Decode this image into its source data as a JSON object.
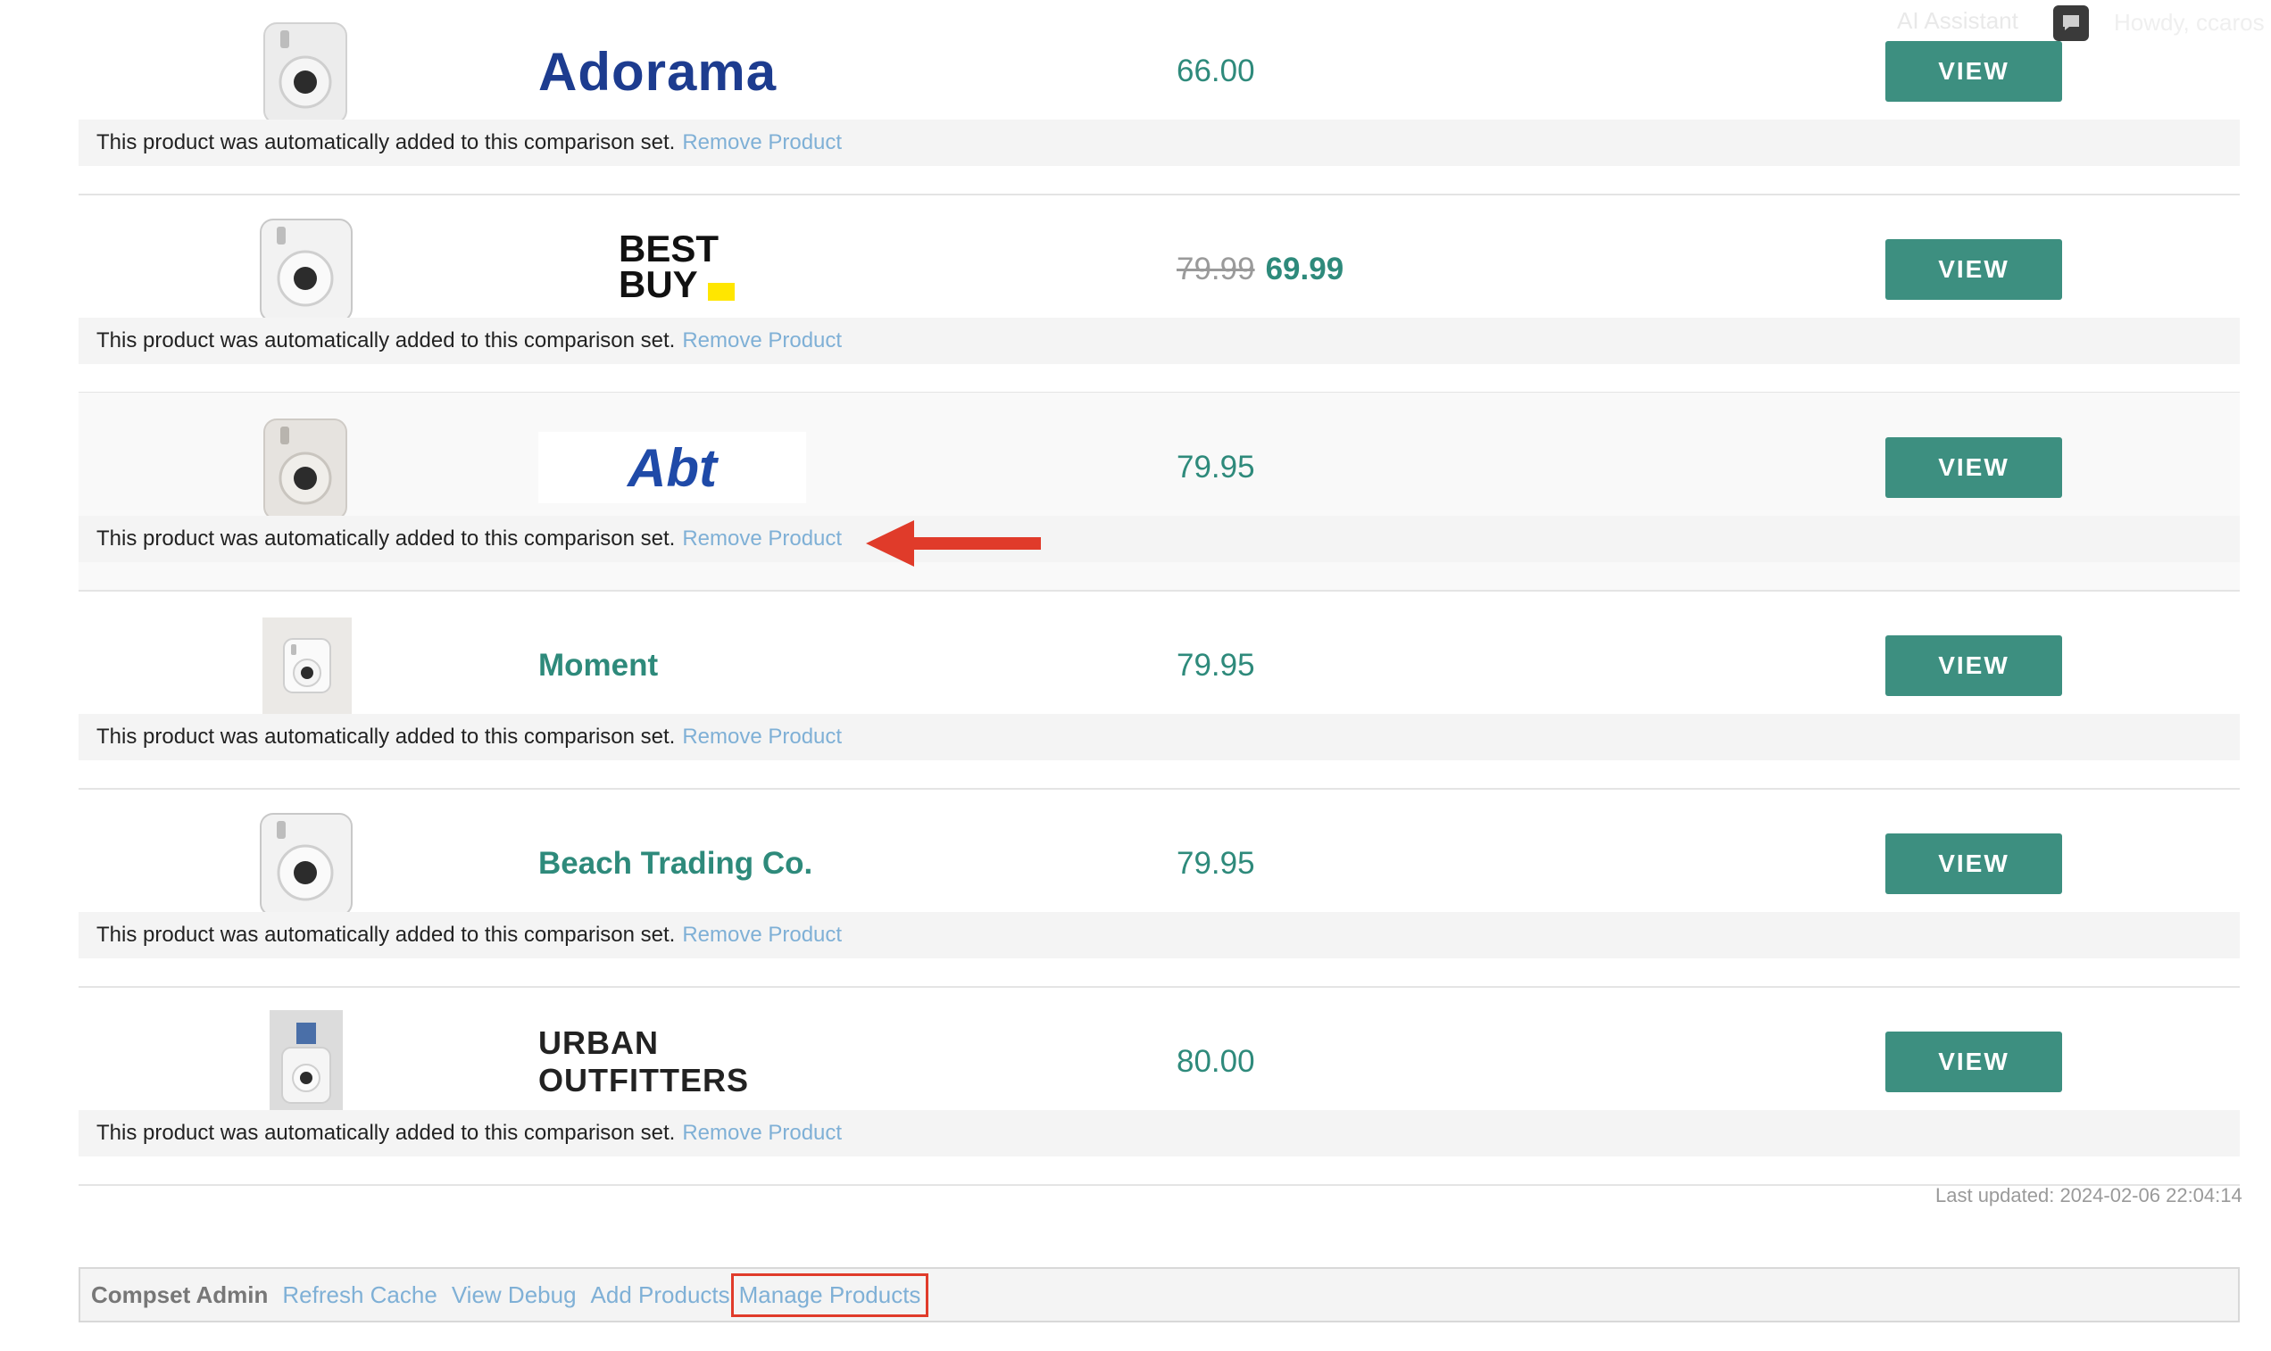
{
  "topbar": {
    "ai_label": "AI Assistant",
    "howdy": "Howdy, ccaros"
  },
  "rows": [
    {
      "store": "Adorama",
      "store_logo": "adorama-logo",
      "price": "66.00",
      "old_price": "",
      "view_label": "VIEW",
      "notice": "This product was automatically added to this comparison set.",
      "remove_label": "Remove Product"
    },
    {
      "store": "BEST BUY",
      "store_logo": "best-buy-logo",
      "price": "69.99",
      "old_price": "79.99",
      "view_label": "VIEW",
      "notice": "This product was automatically added to this comparison set.",
      "remove_label": "Remove Product"
    },
    {
      "store": "Abt",
      "store_logo": "abt-logo",
      "price": "79.95",
      "old_price": "",
      "view_label": "VIEW",
      "notice": "This product was automatically added to this comparison set.",
      "remove_label": "Remove Product"
    },
    {
      "store": "Moment",
      "store_logo": "",
      "price": "79.95",
      "old_price": "",
      "view_label": "VIEW",
      "notice": "This product was automatically added to this comparison set.",
      "remove_label": "Remove Product"
    },
    {
      "store": "Beach Trading Co.",
      "store_logo": "",
      "price": "79.95",
      "old_price": "",
      "view_label": "VIEW",
      "notice": "This product was automatically added to this comparison set.",
      "remove_label": "Remove Product"
    },
    {
      "store": "URBAN OUTFITTERS",
      "store_logo": "urban-outfitters-logo",
      "price": "80.00",
      "old_price": "",
      "view_label": "VIEW",
      "notice": "This product was automatically added to this comparison set.",
      "remove_label": "Remove Product"
    }
  ],
  "last_updated": "Last updated: 2024-02-06 22:04:14",
  "admin": {
    "title": "Compset Admin",
    "refresh_cache": "Refresh Cache",
    "view_debug": "View Debug",
    "add_products": "Add Products",
    "manage_products": "Manage Products"
  },
  "colors": {
    "accent": "#3d8f80",
    "price": "#2e8a7b",
    "link": "#7fb0d6",
    "annotation": "#e03b2a"
  }
}
